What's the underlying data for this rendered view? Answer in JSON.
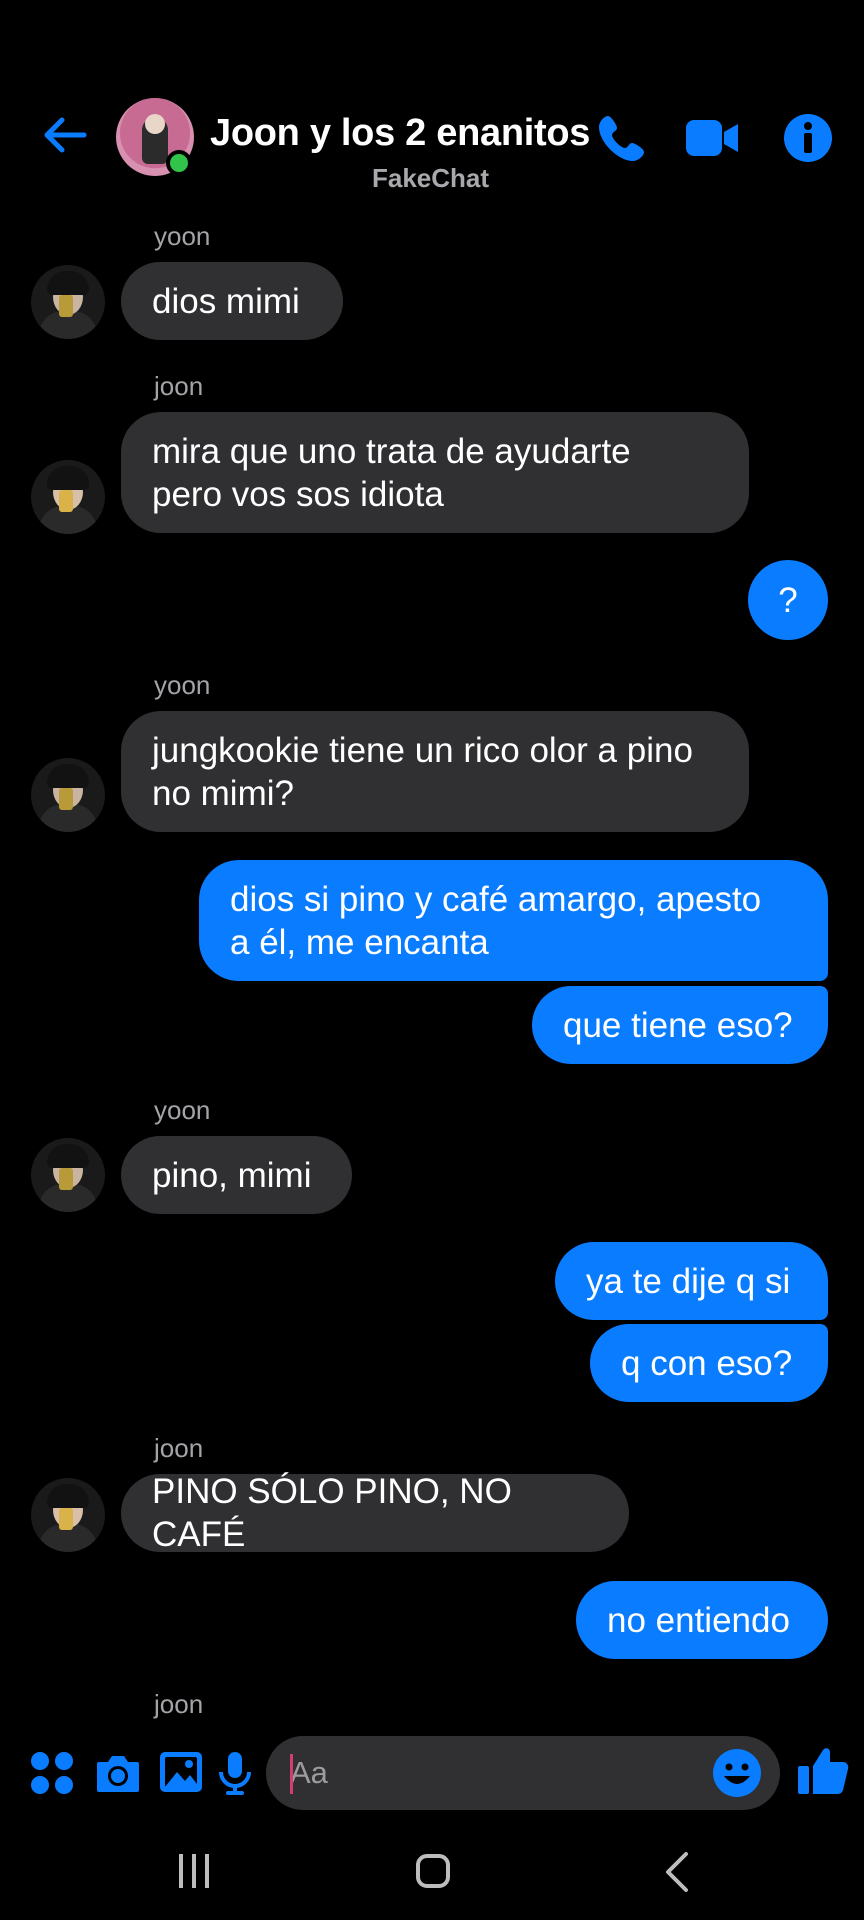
{
  "header": {
    "title": "Joon y los 2 enanitos",
    "subtitle": "FakeChat",
    "back_icon": "arrow-left-icon",
    "call_icon": "phone-icon",
    "video_icon": "video-camera-icon",
    "info_icon": "info-icon",
    "accent": "#0a7cff",
    "online_color": "#31c34a"
  },
  "messages": [
    {
      "sender": "yoon",
      "text_lines": [
        "dios mimi"
      ],
      "direction": "in"
    },
    {
      "sender": "joon",
      "text_lines": [
        "mira que uno trata de ayudarte",
        "pero vos sos idiota"
      ],
      "direction": "in"
    },
    {
      "text_lines": [
        "?"
      ],
      "direction": "out"
    },
    {
      "sender": "yoon",
      "text_lines": [
        "jungkookie tiene un rico olor a pino",
        "no mimi?"
      ],
      "direction": "in"
    },
    {
      "text_lines": [
        "dios si pino y café amargo, apesto",
        "a él, me encanta"
      ],
      "direction": "out"
    },
    {
      "text_lines": [
        "que tiene eso?"
      ],
      "direction": "out"
    },
    {
      "sender": "yoon",
      "text_lines": [
        "pino, mimi"
      ],
      "direction": "in"
    },
    {
      "text_lines": [
        "ya te dije q si"
      ],
      "direction": "out"
    },
    {
      "text_lines": [
        "q con eso?"
      ],
      "direction": "out"
    },
    {
      "sender": "joon",
      "text_lines": [
        "PINO SÓLO PINO, NO CAFÉ"
      ],
      "direction": "in"
    },
    {
      "text_lines": [
        "no entiendo"
      ],
      "direction": "out"
    }
  ],
  "typing_sender": "joon",
  "composer": {
    "placeholder": "Aa",
    "icons": [
      "apps-grid-icon",
      "camera-icon",
      "gallery-icon",
      "microphone-icon",
      "emoji-icon",
      "thumbs-up-icon"
    ]
  },
  "nav": {
    "icons": [
      "recent-apps-icon",
      "home-icon",
      "back-icon"
    ]
  }
}
